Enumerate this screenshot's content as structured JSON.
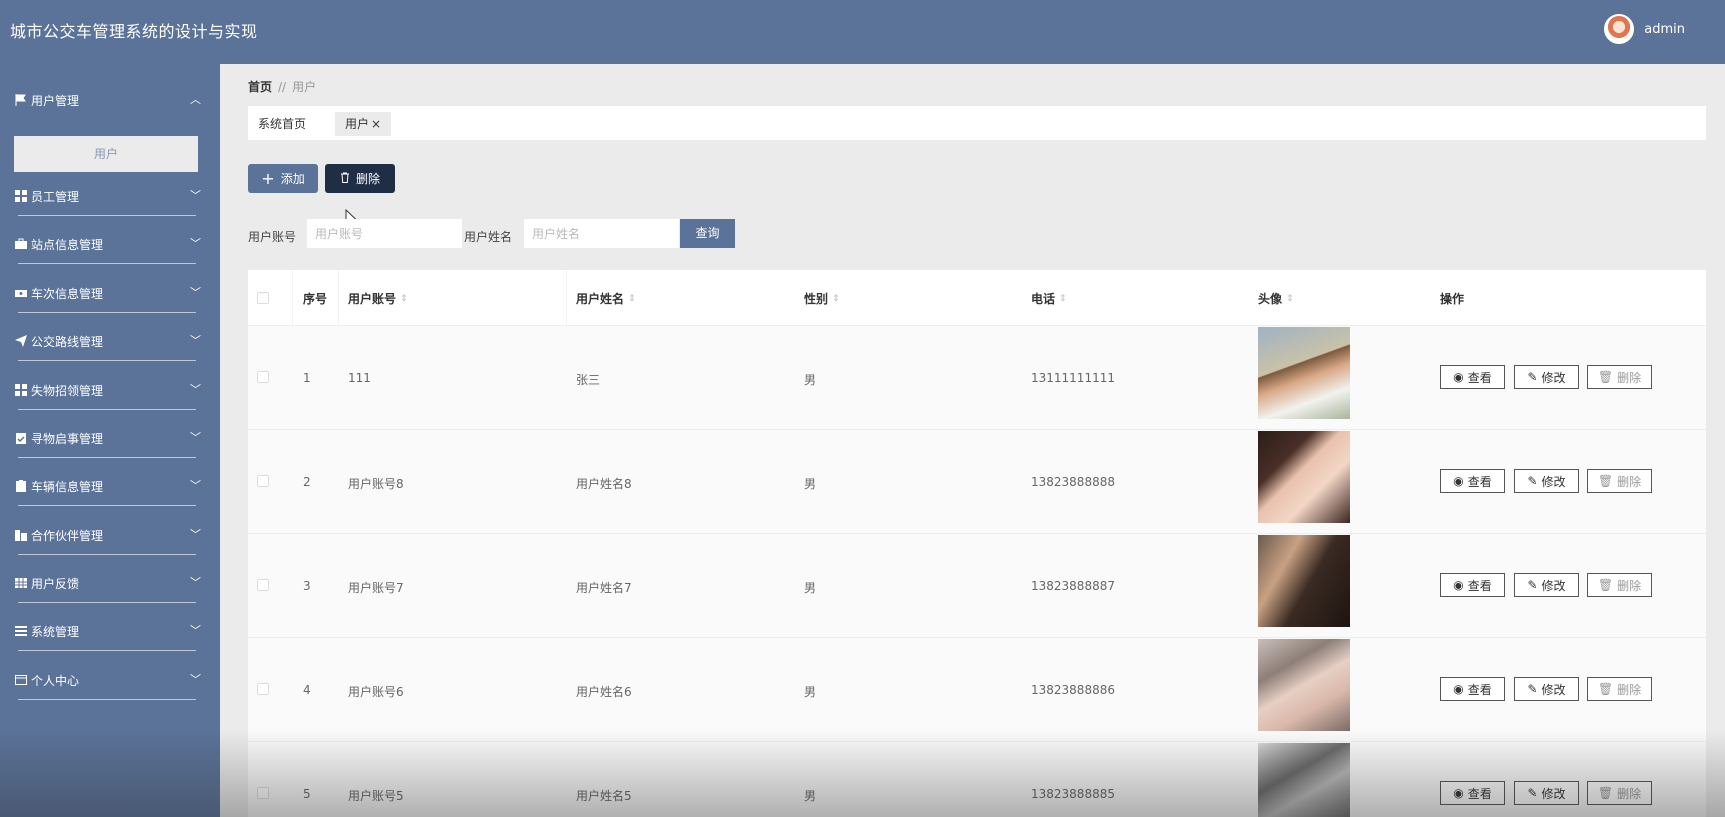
{
  "app": {
    "title": "城市公交车管理系统的设计与实现",
    "username": "admin"
  },
  "sidebar": {
    "items": [
      {
        "label": "用户管理",
        "icon": "flag-icon",
        "expanded": true,
        "sub": [
          "用户"
        ]
      },
      {
        "label": "员工管理",
        "icon": "grid-icon"
      },
      {
        "label": "站点信息管理",
        "icon": "briefcase-icon"
      },
      {
        "label": "车次信息管理",
        "icon": "ticket-icon"
      },
      {
        "label": "公交路线管理",
        "icon": "send-icon"
      },
      {
        "label": "失物招领管理",
        "icon": "grid-icon"
      },
      {
        "label": "寻物启事管理",
        "icon": "clipboard-icon"
      },
      {
        "label": "车辆信息管理",
        "icon": "clipboard-icon"
      },
      {
        "label": "合作伙伴管理",
        "icon": "building-icon"
      },
      {
        "label": "用户反馈",
        "icon": "table-icon"
      },
      {
        "label": "系统管理",
        "icon": "menu-icon"
      },
      {
        "label": "个人中心",
        "icon": "window-icon"
      }
    ]
  },
  "breadcrumb": {
    "home": "首页",
    "separator": "//",
    "current": "用户"
  },
  "tabs": [
    {
      "label": "系统首页"
    },
    {
      "label": "用户",
      "closable": true
    }
  ],
  "toolbar": {
    "add_label": "添加",
    "delete_label": "删除"
  },
  "search": {
    "account_label": "用户账号",
    "account_placeholder": "用户账号",
    "name_label": "用户姓名",
    "name_placeholder": "用户姓名",
    "query_label": "查询"
  },
  "table": {
    "columns": [
      "序号",
      "用户账号",
      "用户姓名",
      "性别",
      "电话",
      "头像",
      "操作"
    ],
    "actions": {
      "view": "查看",
      "edit": "修改",
      "delete": "删除"
    },
    "rows": [
      {
        "index": "1",
        "account": "111",
        "name": "张三",
        "gender": "男",
        "phone": "13111111111"
      },
      {
        "index": "2",
        "account": "用户账号8",
        "name": "用户姓名8",
        "gender": "男",
        "phone": "13823888888"
      },
      {
        "index": "3",
        "account": "用户账号7",
        "name": "用户姓名7",
        "gender": "男",
        "phone": "13823888887"
      },
      {
        "index": "4",
        "account": "用户账号6",
        "name": "用户姓名6",
        "gender": "男",
        "phone": "13823888886"
      },
      {
        "index": "5",
        "account": "用户账号5",
        "name": "用户姓名5",
        "gender": "男",
        "phone": "13823888885"
      }
    ]
  },
  "colors": {
    "primary": "#5b7399",
    "dark_button": "#1f2d45",
    "background": "#ebebeb"
  }
}
